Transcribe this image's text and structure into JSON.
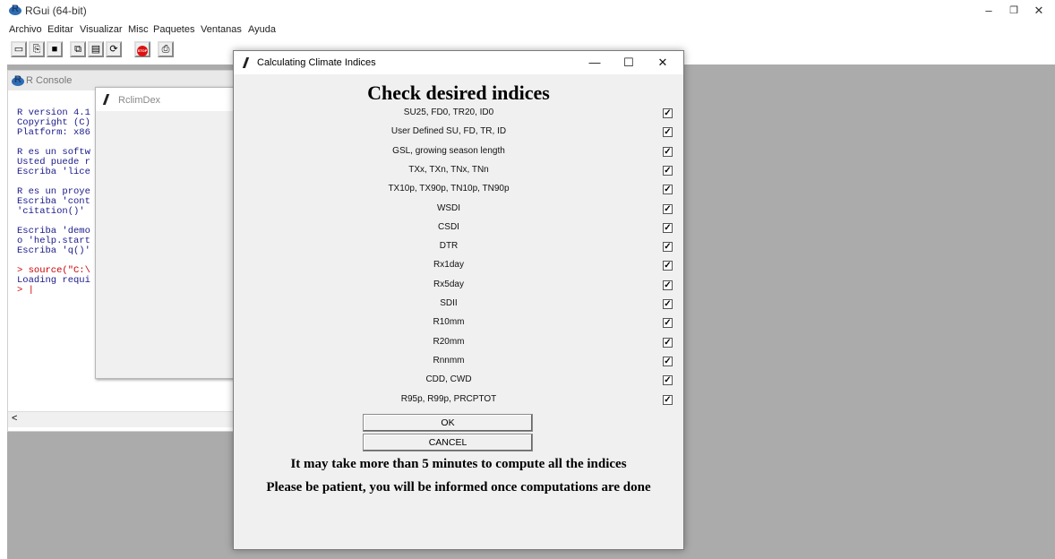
{
  "app": {
    "title": "RGui (64-bit)",
    "controls": {
      "minimize": "–",
      "maximize": "❐",
      "close": "✕"
    }
  },
  "menu": [
    "Archivo",
    "Editar",
    "Visualizar",
    "Misc",
    "Paquetes",
    "Ventanas",
    "Ayuda"
  ],
  "toolbar": {
    "buttons": [
      "open-script-icon",
      "load-workspace-icon",
      "save-icon",
      "copy-icon",
      "paste-icon",
      "copy-paste-icon",
      "stop-icon",
      "print-icon"
    ],
    "stop_label": "STOP"
  },
  "console": {
    "title": "R Console",
    "lines": [
      "R version 4.1",
      "Copyright (C)",
      "Platform: x86",
      "",
      "R es un softw",
      "Usted puede r",
      "Escriba 'lice",
      "",
      "R es un proye",
      "Escriba 'cont",
      "'citation()'",
      "",
      "Escriba 'demo",
      "o 'help.start",
      "Escriba 'q()'",
      ""
    ],
    "cmd_lines": [
      "> source(\"C:\\"
    ],
    "loading_line": "Loading requi",
    "prompt": "> |",
    "scroll_left": "<"
  },
  "rclimdex": {
    "title": "RclimDex"
  },
  "dialog": {
    "title": "Calculating Climate Indices",
    "heading": "Check desired indices",
    "indices": [
      {
        "label": "SU25, FD0, TR20, ID0",
        "checked": true
      },
      {
        "label": "User Defined SU, FD, TR, ID",
        "checked": true
      },
      {
        "label": "GSL, growing season length",
        "checked": true
      },
      {
        "label": "TXx, TXn, TNx, TNn",
        "checked": true
      },
      {
        "label": "TX10p, TX90p, TN10p, TN90p",
        "checked": true
      },
      {
        "label": "WSDI",
        "checked": true
      },
      {
        "label": "CSDI",
        "checked": true
      },
      {
        "label": "DTR",
        "checked": true
      },
      {
        "label": "Rx1day",
        "checked": true
      },
      {
        "label": "Rx5day",
        "checked": true
      },
      {
        "label": "SDII",
        "checked": true
      },
      {
        "label": "R10mm",
        "checked": true
      },
      {
        "label": "R20mm",
        "checked": true
      },
      {
        "label": "Rnnmm",
        "checked": true
      },
      {
        "label": "CDD, CWD",
        "checked": true
      },
      {
        "label": "R95p, R99p, PRCPTOT",
        "checked": true
      }
    ],
    "ok_label": "OK",
    "cancel_label": "CANCEL",
    "message1": "It may take more than 5 minutes to compute all the indices",
    "message2": "Please be patient, you will be informed once computations are done",
    "controls": {
      "minimize": "—",
      "maximize": "☐",
      "close": "✕"
    }
  }
}
